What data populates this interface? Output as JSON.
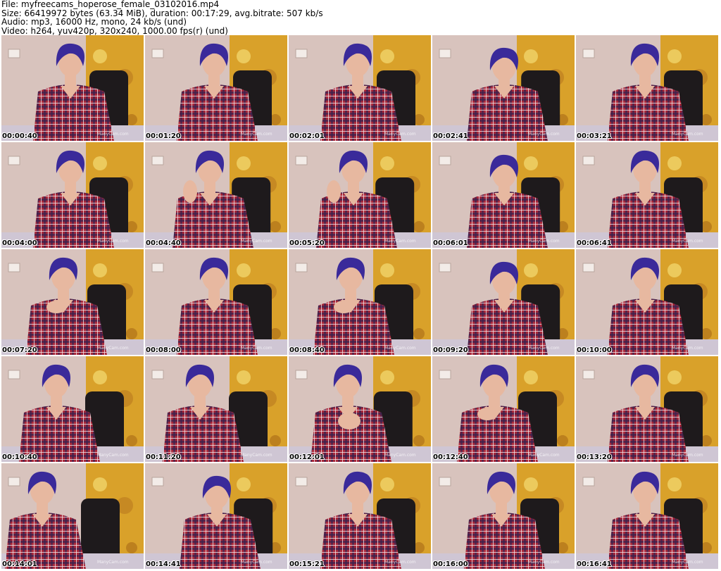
{
  "header": {
    "file_line": "File: myfreecams_hoperose_female_03102016.mp4",
    "size_line": "Size: 66419972 bytes (63.34 MiB), duration: 00:17:29, avg.bitrate: 507 kb/s",
    "audio_line": "Audio: mp3, 16000 Hz, mono, 24 kb/s (und)",
    "video_line": "Video: h264, yuv420p, 320x240, 1000.00 fps(r) (und)"
  },
  "watermark": "ManyCam.com",
  "frames": [
    {
      "time": "00:00:40",
      "pose": "center"
    },
    {
      "time": "00:01:20",
      "pose": "center"
    },
    {
      "time": "00:02:01",
      "pose": "center"
    },
    {
      "time": "00:02:41",
      "pose": "down"
    },
    {
      "time": "00:03:21",
      "pose": "center"
    },
    {
      "time": "00:04:00",
      "pose": "center"
    },
    {
      "time": "00:04:40",
      "pose": "hand"
    },
    {
      "time": "00:05:20",
      "pose": "hand"
    },
    {
      "time": "00:06:01",
      "pose": "down"
    },
    {
      "time": "00:06:41",
      "pose": "center"
    },
    {
      "time": "00:07:20",
      "pose": "chin"
    },
    {
      "time": "00:08:00",
      "pose": "center"
    },
    {
      "time": "00:08:40",
      "pose": "chin"
    },
    {
      "time": "00:09:20",
      "pose": "down"
    },
    {
      "time": "00:10:00",
      "pose": "center"
    },
    {
      "time": "00:10:40",
      "pose": "left"
    },
    {
      "time": "00:11:20",
      "pose": "left"
    },
    {
      "time": "00:12:01",
      "pose": "hands"
    },
    {
      "time": "00:12:40",
      "pose": "chin"
    },
    {
      "time": "00:13:20",
      "pose": "center"
    },
    {
      "time": "00:14:01",
      "pose": "farleft"
    },
    {
      "time": "00:14:41",
      "pose": "down"
    },
    {
      "time": "00:15:21",
      "pose": "center"
    },
    {
      "time": "00:16:00",
      "pose": "center"
    },
    {
      "time": "00:16:41",
      "pose": "center"
    }
  ],
  "colors": {
    "wall": "#d8c3bd",
    "painting_gold": "#d9a12a",
    "hair": "#3a2a9a",
    "shirt_red": "#a8283a",
    "shirt_dark": "#3a2250",
    "skin": "#e7b8a0",
    "chair": "#1e1a1c"
  }
}
